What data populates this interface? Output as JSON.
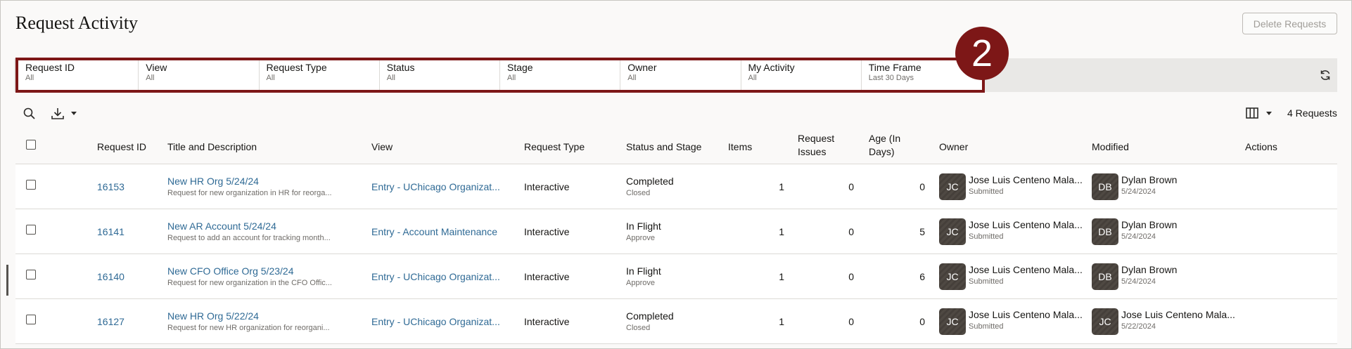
{
  "header": {
    "title": "Request Activity",
    "delete_label": "Delete Requests"
  },
  "filters": [
    {
      "label": "Request ID",
      "value": "All"
    },
    {
      "label": "View",
      "value": "All"
    },
    {
      "label": "Request Type",
      "value": "All"
    },
    {
      "label": "Status",
      "value": "All"
    },
    {
      "label": "Stage",
      "value": "All"
    },
    {
      "label": "Owner",
      "value": "All"
    },
    {
      "label": "My Activity",
      "value": "All"
    },
    {
      "label": "Time Frame",
      "value": "Last 30 Days"
    }
  ],
  "callout": "2",
  "toolbar": {
    "count": "4 Requests",
    "icons": [
      "search-icon",
      "download-icon",
      "columns-icon",
      "refresh-icon"
    ]
  },
  "columns": {
    "request_id": "Request ID",
    "title": "Title and Description",
    "view": "View",
    "type": "Request Type",
    "status": "Status and Stage",
    "items": "Items",
    "issues_1": "Request",
    "issues_2": "Issues",
    "age_1": "Age (In",
    "age_2": "Days)",
    "owner": "Owner",
    "modified": "Modified",
    "actions": "Actions"
  },
  "rows": [
    {
      "id": "16153",
      "title": "New HR Org 5/24/24",
      "desc": "Request for new organization in HR for reorga...",
      "view": "Entry - UChicago Organizat...",
      "type": "Interactive",
      "status": "Completed",
      "stage": "Closed",
      "items": "1",
      "issues": "0",
      "age": "0",
      "owner_initials": "JC",
      "owner_name": "Jose Luis Centeno Mala...",
      "owner_sub": "Submitted",
      "mod_initials": "DB",
      "mod_name": "Dylan Brown",
      "mod_date": "5/24/2024"
    },
    {
      "id": "16141",
      "title": "New AR Account 5/24/24",
      "desc": "Request to add an account for tracking month...",
      "view": "Entry - Account Maintenance",
      "type": "Interactive",
      "status": "In Flight",
      "stage": "Approve",
      "items": "1",
      "issues": "0",
      "age": "5",
      "owner_initials": "JC",
      "owner_name": "Jose Luis Centeno Mala...",
      "owner_sub": "Submitted",
      "mod_initials": "DB",
      "mod_name": "Dylan Brown",
      "mod_date": "5/24/2024"
    },
    {
      "id": "16140",
      "title": "New CFO Office Org 5/23/24",
      "desc": "Request for new organization in the CFO Offic...",
      "view": "Entry - UChicago Organizat...",
      "type": "Interactive",
      "status": "In Flight",
      "stage": "Approve",
      "items": "1",
      "issues": "0",
      "age": "6",
      "owner_initials": "JC",
      "owner_name": "Jose Luis Centeno Mala...",
      "owner_sub": "Submitted",
      "mod_initials": "DB",
      "mod_name": "Dylan Brown",
      "mod_date": "5/24/2024"
    },
    {
      "id": "16127",
      "title": "New HR Org 5/22/24",
      "desc": "Request for new HR organization for reorgani...",
      "view": "Entry - UChicago Organizat...",
      "type": "Interactive",
      "status": "Completed",
      "stage": "Closed",
      "items": "1",
      "issues": "0",
      "age": "0",
      "owner_initials": "JC",
      "owner_name": "Jose Luis Centeno Mala...",
      "owner_sub": "Submitted",
      "mod_initials": "JC",
      "mod_name": "Jose Luis Centeno Mala...",
      "mod_date": "5/22/2024"
    }
  ]
}
